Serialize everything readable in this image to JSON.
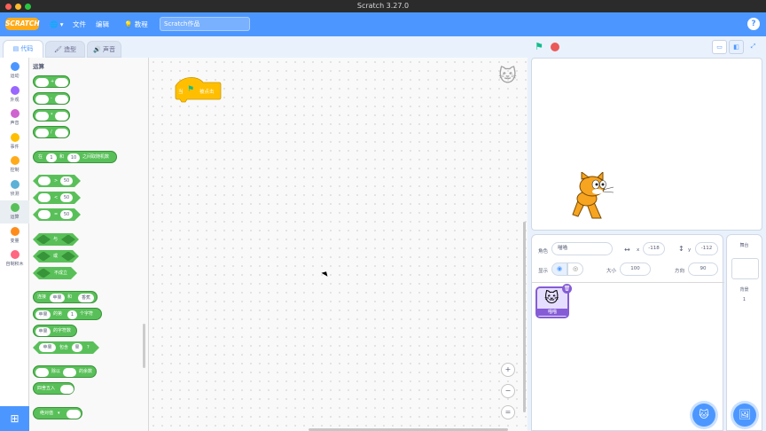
{
  "window": {
    "title": "Scratch 3.27.0"
  },
  "menu": {
    "logo": "SCRATCH",
    "globe": "🌐",
    "file": "文件",
    "edit": "编辑",
    "tutorials": "教程",
    "project_title": "Scratch作品",
    "help": "?"
  },
  "tabs": [
    {
      "label": "代码",
      "icon": "code-icon"
    },
    {
      "label": "造型",
      "icon": "costume-icon"
    },
    {
      "label": "声音",
      "icon": "sound-icon"
    }
  ],
  "categories": [
    {
      "label": "运动",
      "color": "#4c97ff"
    },
    {
      "label": "外观",
      "color": "#9966ff"
    },
    {
      "label": "声音",
      "color": "#cf63cf"
    },
    {
      "label": "事件",
      "color": "#ffbf00"
    },
    {
      "label": "控制",
      "color": "#ffab19"
    },
    {
      "label": "侦测",
      "color": "#5cb1d6"
    },
    {
      "label": "运算",
      "color": "#59c059"
    },
    {
      "label": "变量",
      "color": "#ff8c1a"
    },
    {
      "label": "自制积木",
      "color": "#ff6680"
    }
  ],
  "palette": {
    "title": "运算",
    "ops": [
      "+",
      "-",
      "*",
      "/"
    ],
    "random": {
      "pre": "在",
      "from": "1",
      "mid": "和",
      "to": "10",
      "post": "之间取随机数"
    },
    "compare": [
      {
        "op": ">",
        "value": "50"
      },
      {
        "op": "<",
        "value": "50"
      },
      {
        "op": "=",
        "value": "50"
      }
    ],
    "logic": [
      "与",
      "或",
      "不成立"
    ],
    "join": {
      "label": "连接",
      "a": "苹果",
      "b": "和",
      "c": "香蕉"
    },
    "letter": {
      "a": "苹果",
      "of": "的第",
      "n": "1",
      "post": "个字符"
    },
    "length": {
      "a": "苹果",
      "post": "的字符数"
    },
    "contains": {
      "a": "苹果",
      "mid": "包含",
      "b": "果",
      "post": "?"
    },
    "mod": {
      "mid": "除以",
      "post": "的余数"
    },
    "round": {
      "label": "四舍五入"
    },
    "abs": {
      "label": "绝对值"
    }
  },
  "script": {
    "hat_block": {
      "pre": "当",
      "post": "被点击"
    }
  },
  "zoom": {
    "in": "+",
    "out": "−",
    "reset": "="
  },
  "sprite_info": {
    "sprite_label": "角色",
    "sprite_name": "喵喵",
    "x_label": "x",
    "x": "-118",
    "y_label": "y",
    "y": "-112",
    "show_label": "显示",
    "size_label": "大小",
    "size": "100",
    "direction_label": "方向",
    "direction": "90"
  },
  "sprites": [
    {
      "name": "喵喵"
    }
  ],
  "stage_pane": {
    "title": "舞台",
    "backdrops_label": "背景",
    "backdrops_count": "1"
  }
}
